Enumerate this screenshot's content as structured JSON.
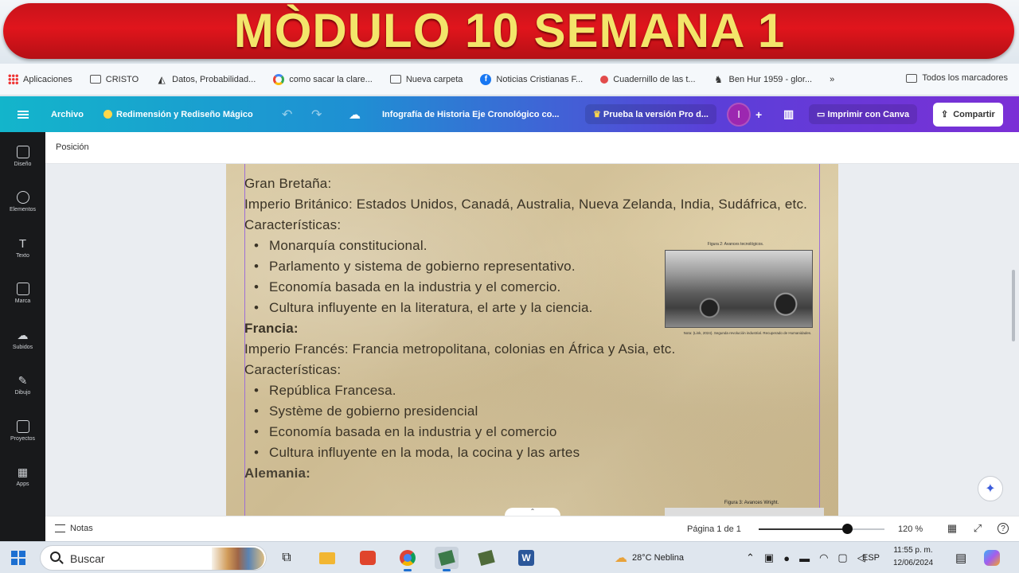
{
  "banner": {
    "title": "MÒDULO 10 SEMANA 1"
  },
  "bookmarks": {
    "items": [
      {
        "label": "Aplicaciones",
        "icon": "apps-icon"
      },
      {
        "label": "CRISTO",
        "icon": "folder-icon"
      },
      {
        "label": "Datos, Probabilidad...",
        "icon": "site-icon"
      },
      {
        "label": "como sacar la clare...",
        "icon": "google-icon"
      },
      {
        "label": "Nueva carpeta",
        "icon": "folder-icon"
      },
      {
        "label": "Noticias Cristianas F...",
        "icon": "facebook-icon"
      },
      {
        "label": "Cuadernillo de las t...",
        "icon": "site-icon"
      },
      {
        "label": "Ben Hur 1959 - glor...",
        "icon": "site-icon"
      }
    ],
    "overflow": "»",
    "all_bookmarks": "Todos los marcadores"
  },
  "topbar": {
    "file": "Archivo",
    "magic": "Redimensión y Rediseño Mágico",
    "doc_title": "Infografía de Historia Eje Cronológico co...",
    "pro_trial": "Prueba la versión Pro d...",
    "avatar_initial": "I",
    "plus": "+",
    "print": "Imprimir con Canva",
    "share": "Compartir"
  },
  "sidebar": {
    "items": [
      {
        "label": "Diseño",
        "icon": "design-icon"
      },
      {
        "label": "Elementos",
        "icon": "elements-icon"
      },
      {
        "label": "Texto",
        "icon": "text-icon"
      },
      {
        "label": "Marca",
        "icon": "brand-icon"
      },
      {
        "label": "Subidos",
        "icon": "uploads-icon"
      },
      {
        "label": "Dibujo",
        "icon": "draw-icon"
      },
      {
        "label": "Proyectos",
        "icon": "projects-icon"
      },
      {
        "label": "Apps",
        "icon": "apps-icon"
      }
    ]
  },
  "context": {
    "position": "Posición"
  },
  "document": {
    "gb_heading": "Gran Bretaña:",
    "gb_empire": "Imperio Británico: Estados Unidos, Canadá, Australia, Nueva Zelanda, India, Sudáfrica, etc.",
    "gb_char": "Características:",
    "gb_items": [
      "Monarquía constitucional.",
      "Parlamento y sistema de gobierno representativo.",
      "Economía basada en la industria y el comercio.",
      "Cultura influyente en la literatura, el arte y la ciencia."
    ],
    "fr_heading": "Francia:",
    "fr_empire": "Imperio Francés: Francia metropolitana, colonias en África y Asia, etc.",
    "fr_char": "Características:",
    "fr_items": [
      "República Francesa.",
      "Système de gobierno presidencial",
      "Economía basada en la industria y el comercio",
      "Cultura influyente en la moda, la cocina y las artes"
    ],
    "de_heading": "Alemania:",
    "figure1_caption": "Figura 2: Avances tecnológicos.",
    "figure1_credit": "Nota: (Link, 2024). Segunda revolución industrial. Recuperado de Humanidades.",
    "figure2_caption": "Figura 3: Avances Wright."
  },
  "bottombar": {
    "notes": "Notas",
    "page_indicator": "Página 1 de 1",
    "zoom_label": "120 %",
    "zoom_fraction": 0.7
  },
  "taskbar": {
    "search": "Buscar",
    "weather": "28°C  Neblina",
    "lang": "ESP",
    "time": "11:55 p. m.",
    "date": "12/06/2024"
  }
}
